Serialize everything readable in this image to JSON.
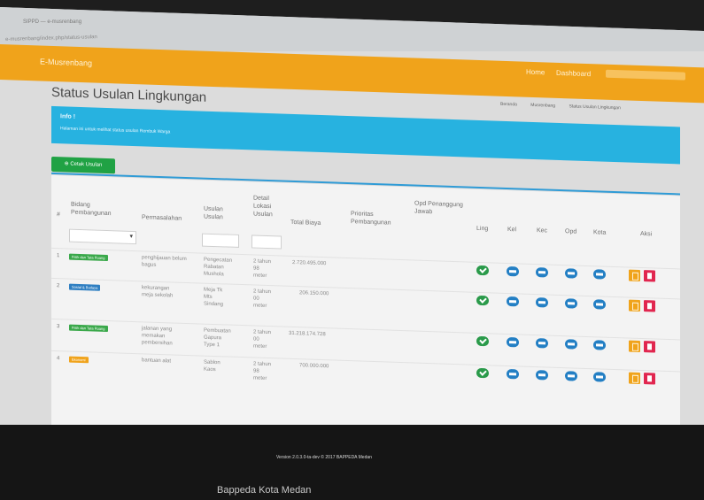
{
  "browser": {
    "tab_title": "SIPPD — e-musrenbang",
    "url": "e-musrenbang/index.php/status-usulan"
  },
  "topnav": {
    "brand": "E-Musrenbang",
    "links": [
      "Home",
      "Dashboard"
    ]
  },
  "page": {
    "title": "Status Usulan Lingkungan",
    "breadcrumb": [
      "Beranda",
      "Musrenbang",
      "Status Usulan Lingkungan"
    ]
  },
  "info": {
    "title": "Info !",
    "text": "Halaman ini untuk melihat status usulan Rembuk Warga"
  },
  "actions": {
    "cetak_label": "Cetak Usulan"
  },
  "table": {
    "headers": {
      "no": "#",
      "bidang": "Bidang Pembangunan",
      "permasalahan": "Permasalahan",
      "usulan": "Usulan Usulan",
      "detail": "Detail Lokasi Usulan",
      "biaya": "Total Biaya",
      "prioritas": "Prioritas Pembangunan",
      "opd": "Opd Penanggung Jawab",
      "ling": "Ling",
      "kel": "Kel",
      "kec": "Kec",
      "opd2": "Opd",
      "kota": "Kota",
      "aksi": "Aksi"
    },
    "rows": [
      {
        "no": "1",
        "bidang": "Fisik dan Tata Ruang",
        "bidang_color": "#3aa84a",
        "permasalahan": [
          "penghijauan belum",
          "bagus"
        ],
        "usulan": [
          "Pengecatan",
          "Rabatan",
          "Mushola"
        ],
        "detail": [
          "2 tahun",
          "98",
          "meter"
        ],
        "biaya": "2.720.495.000"
      },
      {
        "no": "2",
        "bidang": "Sosial & Budaya",
        "bidang_color": "#2f7fc2",
        "permasalahan": [
          "kekurangan",
          "meja sekolah"
        ],
        "usulan": [
          "Meja Tk",
          "Mts",
          "Sindang"
        ],
        "detail": [
          "2 tahun",
          "00",
          "meter"
        ],
        "biaya": "206.150.000"
      },
      {
        "no": "3",
        "bidang": "Fisik dan Tata Ruang",
        "bidang_color": "#3aa84a",
        "permasalahan": [
          "jalanan yang",
          "memakan",
          "pembersihan"
        ],
        "usulan": [
          "Pembuatan",
          "Gapura",
          "Type 1"
        ],
        "detail": [
          "2 tahun",
          "00",
          "meter"
        ],
        "biaya": "31.218.174.728"
      },
      {
        "no": "4",
        "bidang": "Ekonomi",
        "bidang_color": "#f0a31b",
        "permasalahan": [
          "bantuan alat"
        ],
        "usulan": [
          "Sablon",
          "Kaos"
        ],
        "detail": [
          "2 tahun",
          "98",
          "meter"
        ],
        "biaya": "700.000.000"
      }
    ]
  },
  "footer": {
    "version": "Version 2.0.3.0-ta-dev © 2017 BAPPEDA Medan",
    "bottom_text": "Bappeda Kota Medan"
  },
  "colors": {
    "nav": "#f0a31b",
    "info": "#27b2e0",
    "ok": "#2a9a4a",
    "pending": "#237fc4",
    "edit": "#f0a31b",
    "delete": "#e1264f"
  }
}
